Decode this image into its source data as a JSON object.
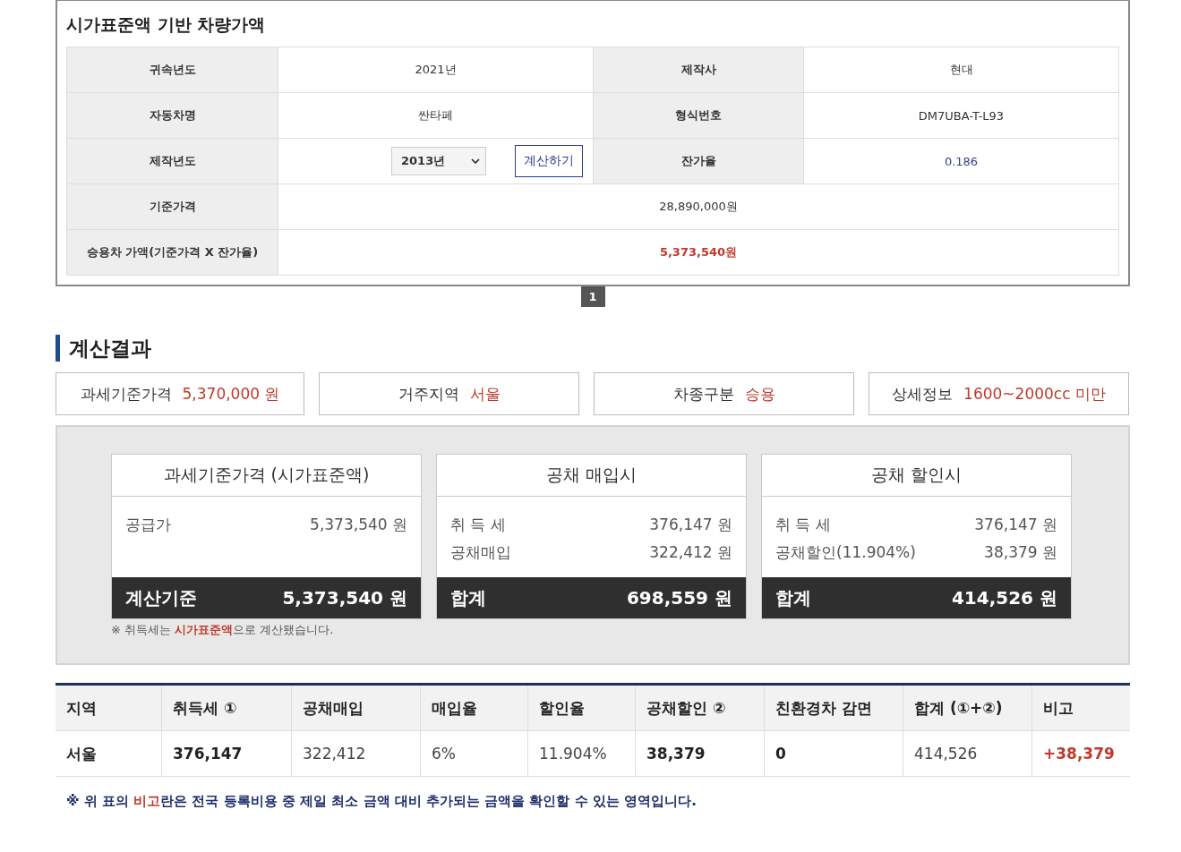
{
  "vehicle_price": {
    "title": "시가표준액 기반 차량가액",
    "rows": [
      [
        {
          "kind": "label",
          "text": "귀속년도"
        },
        {
          "kind": "value",
          "text": "2021년"
        },
        {
          "kind": "label",
          "text": "제작사"
        },
        {
          "kind": "value",
          "text": "현대"
        }
      ],
      [
        {
          "kind": "label",
          "text": "자동차명"
        },
        {
          "kind": "value",
          "text": "싼타페"
        },
        {
          "kind": "label",
          "text": "형식번호"
        },
        {
          "kind": "value",
          "text": "DM7UBA-T-L93"
        }
      ],
      [
        {
          "kind": "label",
          "text": "제작년도"
        },
        {
          "kind": "controls",
          "select": "2013년",
          "button": "계산하기"
        },
        {
          "kind": "label",
          "text": "잔가율"
        },
        {
          "kind": "link",
          "text": "0.186"
        }
      ],
      [
        {
          "kind": "label",
          "text": "기준가격"
        },
        {
          "kind": "value",
          "text": "28,890,000원"
        }
      ],
      [
        {
          "kind": "label",
          "text": "승용차 가액(기준가격 X 잔가율)"
        },
        {
          "kind": "accent",
          "text": "5,373,540원"
        }
      ]
    ]
  },
  "pagination": [
    {
      "label": "1",
      "selected": true
    }
  ],
  "result": {
    "title": "계산결과",
    "summary": [
      {
        "label": "과세기준가격",
        "value": "5,370,000 원"
      },
      {
        "label": "거주지역",
        "value": "서울"
      },
      {
        "label": "차종구분",
        "value": "승용"
      },
      {
        "label": "상세정보",
        "value": "1600~2000cc 미만"
      }
    ],
    "cards": [
      {
        "title": "과세기준가격 (시가표준액)",
        "lines": [
          {
            "label": "공급가",
            "value": "5,373,540 원"
          }
        ],
        "total": {
          "label": "계산기준",
          "value": "5,373,540 원"
        }
      },
      {
        "title": "공채 매입시",
        "lines": [
          {
            "label": "취 득 세",
            "value": "376,147 원"
          },
          {
            "label": "공채매입",
            "value": "322,412 원"
          }
        ],
        "total": {
          "label": "합계",
          "value": "698,559 원"
        }
      },
      {
        "title": "공채 할인시",
        "lines": [
          {
            "label": "취 득 세",
            "value": "376,147 원"
          },
          {
            "label": "공채할인(11.904%)",
            "value": "38,379 원"
          }
        ],
        "total": {
          "label": "합계",
          "value": "414,526 원"
        }
      }
    ],
    "note": "※ 취득세는 **시가표준액**으로 계산됐습니다."
  },
  "table": {
    "columns": [
      "지역",
      "취득세 ①",
      "공채매입",
      "매입율",
      "할인율",
      "공채할인 ②",
      "친환경차 감면",
      "합계 (①+②)",
      "비고"
    ],
    "rows": [
      [
        {
          "kind": "strong",
          "text": "서울"
        },
        {
          "kind": "strong",
          "text": "376,147"
        },
        {
          "kind": "plain",
          "text": "322,412"
        },
        {
          "kind": "plain",
          "text": "6%"
        },
        {
          "kind": "plain",
          "text": "11.904%"
        },
        {
          "kind": "strong",
          "text": "38,379"
        },
        {
          "kind": "strong",
          "text": "0"
        },
        {
          "kind": "plain",
          "text": "414,526"
        },
        {
          "kind": "accent",
          "text": "+38,379"
        }
      ]
    ]
  },
  "footnote": "※ 위 표의 **비고**란은 전국 등록비용 중 제일 최소 금액 대비 추가되는 금액을 확인할 수 있는 영역입니다."
}
